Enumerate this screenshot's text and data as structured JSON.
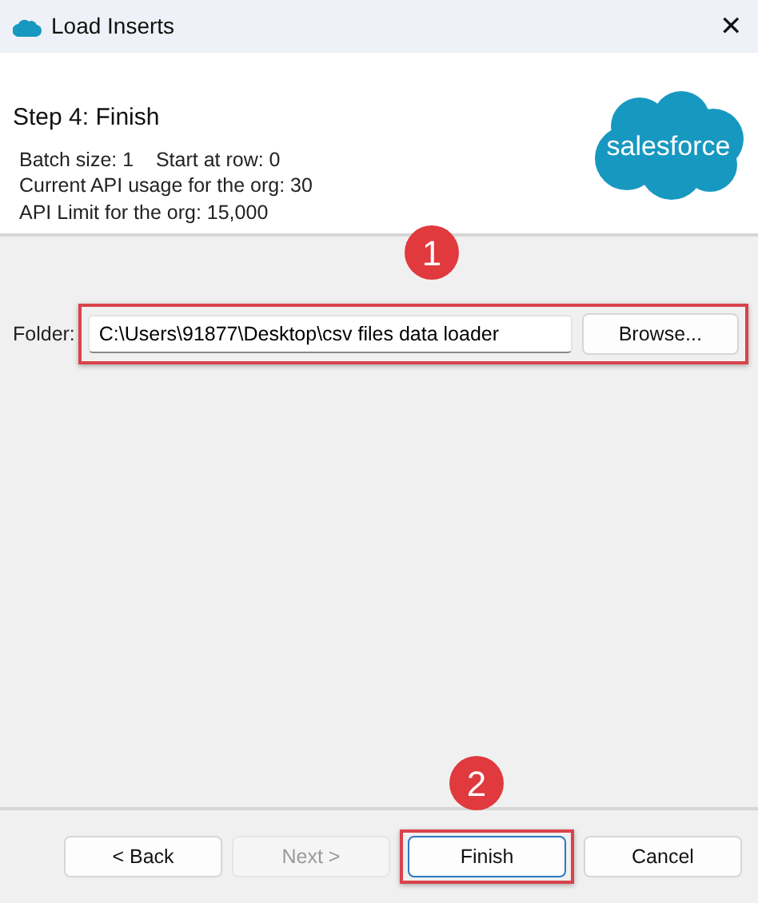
{
  "window": {
    "title": "Load Inserts",
    "close": "✕"
  },
  "header": {
    "step": "Step 4: Finish",
    "logo": "salesforce",
    "info": [
      "Batch size: 1    Start at row: 0",
      "Current API usage for the org: 30",
      "API Limit for the org: 15,000"
    ]
  },
  "folder": {
    "label": "Folder:",
    "value": "C:\\Users\\91877\\Desktop\\csv files data loader",
    "browse": "Browse..."
  },
  "buttons": [
    {
      "label": "< Back",
      "disabled": false,
      "default": false
    },
    {
      "label": "Next >",
      "disabled": true,
      "default": false
    },
    {
      "label": "Finish",
      "disabled": false,
      "default": true
    },
    {
      "label": "Cancel",
      "disabled": false,
      "default": false
    }
  ],
  "annotations": [
    {
      "label": "1"
    },
    {
      "label": "2"
    }
  ]
}
